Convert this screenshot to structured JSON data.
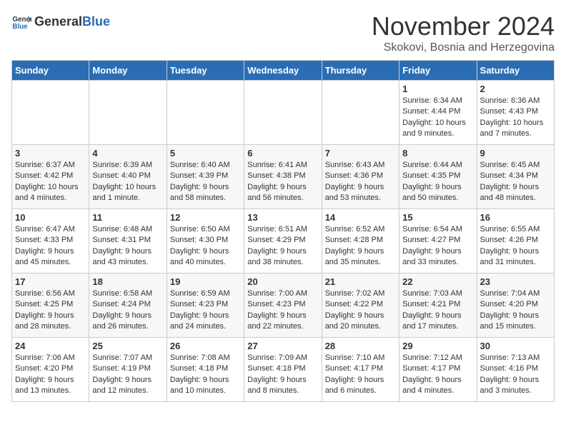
{
  "header": {
    "logo_general": "General",
    "logo_blue": "Blue",
    "month_year": "November 2024",
    "location": "Skokovi, Bosnia and Herzegovina"
  },
  "days_of_week": [
    "Sunday",
    "Monday",
    "Tuesday",
    "Wednesday",
    "Thursday",
    "Friday",
    "Saturday"
  ],
  "weeks": [
    [
      {
        "day": "",
        "info": ""
      },
      {
        "day": "",
        "info": ""
      },
      {
        "day": "",
        "info": ""
      },
      {
        "day": "",
        "info": ""
      },
      {
        "day": "",
        "info": ""
      },
      {
        "day": "1",
        "info": "Sunrise: 6:34 AM\nSunset: 4:44 PM\nDaylight: 10 hours and 9 minutes."
      },
      {
        "day": "2",
        "info": "Sunrise: 6:36 AM\nSunset: 4:43 PM\nDaylight: 10 hours and 7 minutes."
      }
    ],
    [
      {
        "day": "3",
        "info": "Sunrise: 6:37 AM\nSunset: 4:42 PM\nDaylight: 10 hours and 4 minutes."
      },
      {
        "day": "4",
        "info": "Sunrise: 6:39 AM\nSunset: 4:40 PM\nDaylight: 10 hours and 1 minute."
      },
      {
        "day": "5",
        "info": "Sunrise: 6:40 AM\nSunset: 4:39 PM\nDaylight: 9 hours and 58 minutes."
      },
      {
        "day": "6",
        "info": "Sunrise: 6:41 AM\nSunset: 4:38 PM\nDaylight: 9 hours and 56 minutes."
      },
      {
        "day": "7",
        "info": "Sunrise: 6:43 AM\nSunset: 4:36 PM\nDaylight: 9 hours and 53 minutes."
      },
      {
        "day": "8",
        "info": "Sunrise: 6:44 AM\nSunset: 4:35 PM\nDaylight: 9 hours and 50 minutes."
      },
      {
        "day": "9",
        "info": "Sunrise: 6:45 AM\nSunset: 4:34 PM\nDaylight: 9 hours and 48 minutes."
      }
    ],
    [
      {
        "day": "10",
        "info": "Sunrise: 6:47 AM\nSunset: 4:33 PM\nDaylight: 9 hours and 45 minutes."
      },
      {
        "day": "11",
        "info": "Sunrise: 6:48 AM\nSunset: 4:31 PM\nDaylight: 9 hours and 43 minutes."
      },
      {
        "day": "12",
        "info": "Sunrise: 6:50 AM\nSunset: 4:30 PM\nDaylight: 9 hours and 40 minutes."
      },
      {
        "day": "13",
        "info": "Sunrise: 6:51 AM\nSunset: 4:29 PM\nDaylight: 9 hours and 38 minutes."
      },
      {
        "day": "14",
        "info": "Sunrise: 6:52 AM\nSunset: 4:28 PM\nDaylight: 9 hours and 35 minutes."
      },
      {
        "day": "15",
        "info": "Sunrise: 6:54 AM\nSunset: 4:27 PM\nDaylight: 9 hours and 33 minutes."
      },
      {
        "day": "16",
        "info": "Sunrise: 6:55 AM\nSunset: 4:26 PM\nDaylight: 9 hours and 31 minutes."
      }
    ],
    [
      {
        "day": "17",
        "info": "Sunrise: 6:56 AM\nSunset: 4:25 PM\nDaylight: 9 hours and 28 minutes."
      },
      {
        "day": "18",
        "info": "Sunrise: 6:58 AM\nSunset: 4:24 PM\nDaylight: 9 hours and 26 minutes."
      },
      {
        "day": "19",
        "info": "Sunrise: 6:59 AM\nSunset: 4:23 PM\nDaylight: 9 hours and 24 minutes."
      },
      {
        "day": "20",
        "info": "Sunrise: 7:00 AM\nSunset: 4:23 PM\nDaylight: 9 hours and 22 minutes."
      },
      {
        "day": "21",
        "info": "Sunrise: 7:02 AM\nSunset: 4:22 PM\nDaylight: 9 hours and 20 minutes."
      },
      {
        "day": "22",
        "info": "Sunrise: 7:03 AM\nSunset: 4:21 PM\nDaylight: 9 hours and 17 minutes."
      },
      {
        "day": "23",
        "info": "Sunrise: 7:04 AM\nSunset: 4:20 PM\nDaylight: 9 hours and 15 minutes."
      }
    ],
    [
      {
        "day": "24",
        "info": "Sunrise: 7:06 AM\nSunset: 4:20 PM\nDaylight: 9 hours and 13 minutes."
      },
      {
        "day": "25",
        "info": "Sunrise: 7:07 AM\nSunset: 4:19 PM\nDaylight: 9 hours and 12 minutes."
      },
      {
        "day": "26",
        "info": "Sunrise: 7:08 AM\nSunset: 4:18 PM\nDaylight: 9 hours and 10 minutes."
      },
      {
        "day": "27",
        "info": "Sunrise: 7:09 AM\nSunset: 4:18 PM\nDaylight: 9 hours and 8 minutes."
      },
      {
        "day": "28",
        "info": "Sunrise: 7:10 AM\nSunset: 4:17 PM\nDaylight: 9 hours and 6 minutes."
      },
      {
        "day": "29",
        "info": "Sunrise: 7:12 AM\nSunset: 4:17 PM\nDaylight: 9 hours and 4 minutes."
      },
      {
        "day": "30",
        "info": "Sunrise: 7:13 AM\nSunset: 4:16 PM\nDaylight: 9 hours and 3 minutes."
      }
    ]
  ]
}
